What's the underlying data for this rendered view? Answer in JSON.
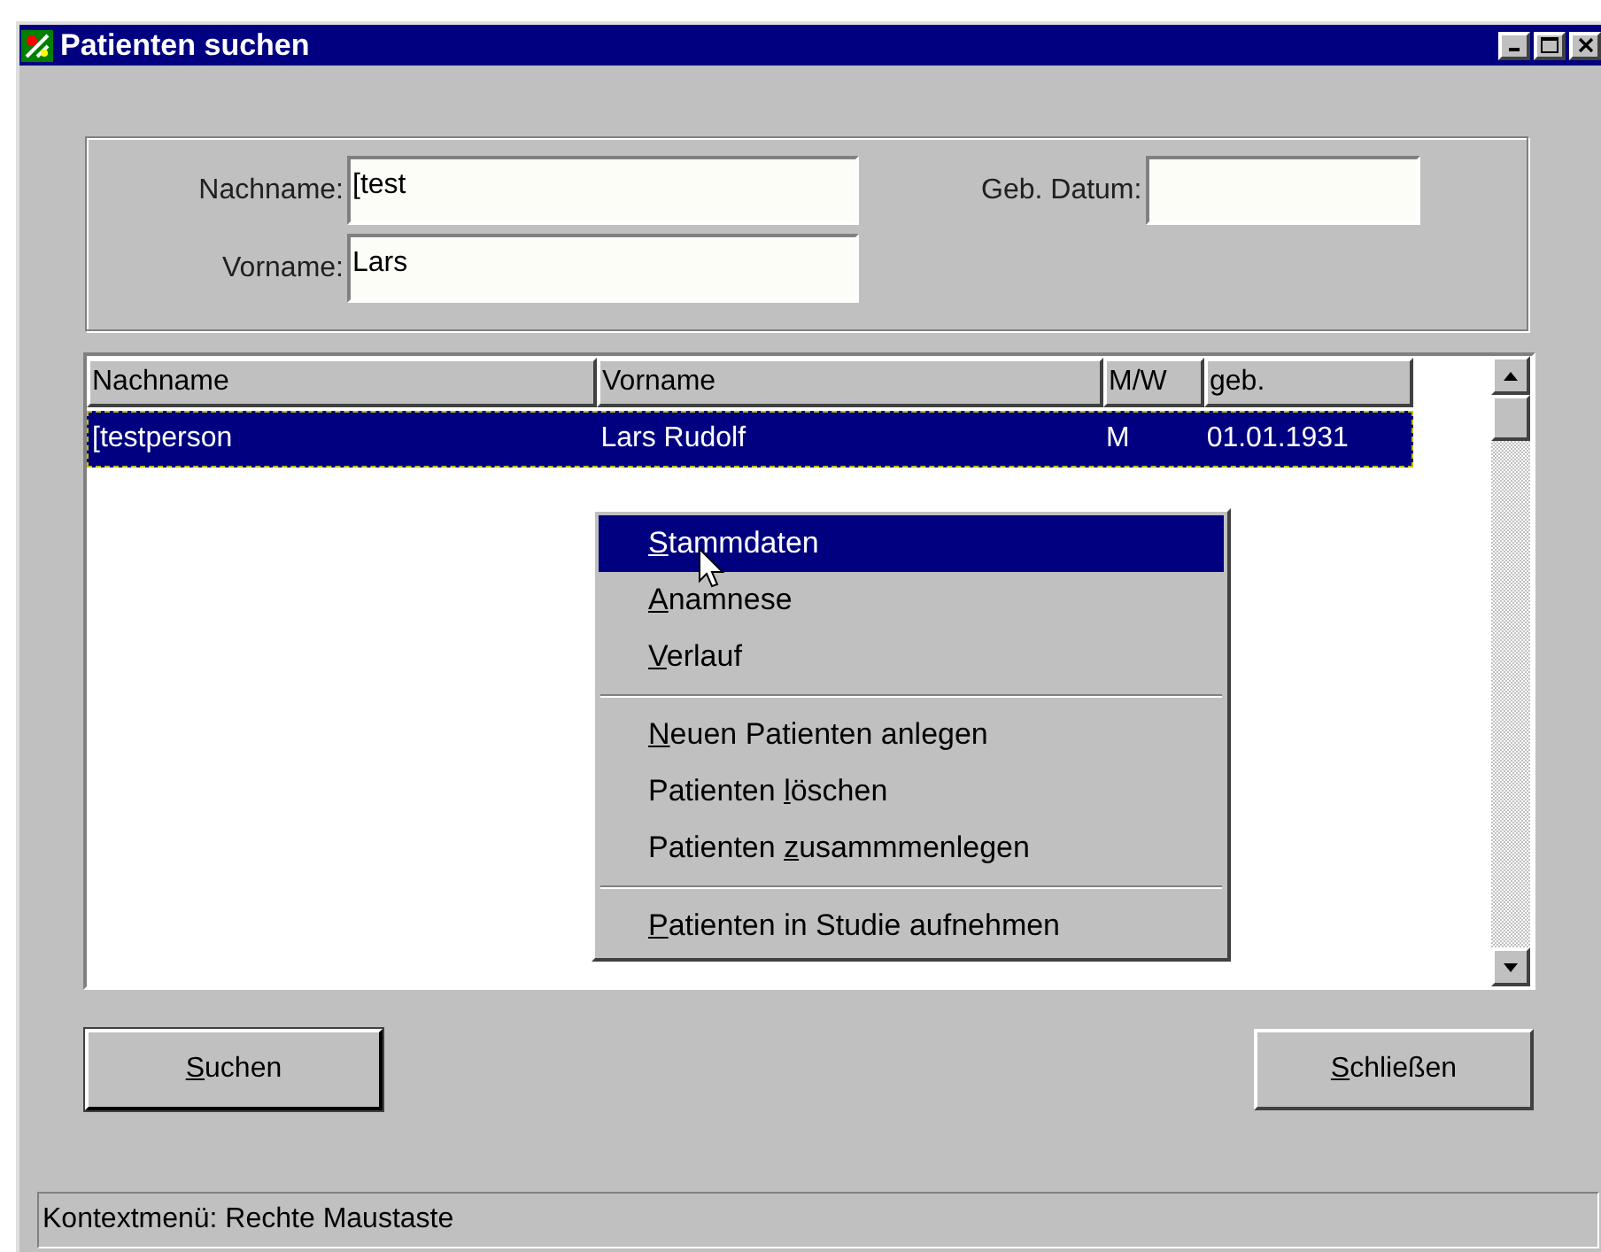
{
  "window": {
    "title": "Patienten suchen"
  },
  "search": {
    "fields": [
      {
        "label": "Nachname:",
        "value": "[test"
      },
      {
        "label": "Vorname:",
        "value": "Lars"
      }
    ],
    "birth_date": {
      "label": "Geb. Datum:"
    }
  },
  "table": {
    "columns": [
      "Nachname",
      "Vorname",
      "M/W",
      "geb."
    ],
    "rows": [
      {
        "cells": [
          "[testperson",
          "Lars Rudolf",
          "M",
          "01.01.1931"
        ],
        "selected": true
      }
    ]
  },
  "context_menu": {
    "groups": [
      [
        {
          "key": "S",
          "rest": "tammdaten",
          "selected": true
        },
        {
          "key": "A",
          "rest": "namnese",
          "selected": false
        },
        {
          "key": "V",
          "rest": "erlauf",
          "selected": false
        }
      ],
      [
        {
          "key": "N",
          "rest": "euen Patienten anlegen",
          "selected": false
        },
        {
          "prefix": "Patienten ",
          "key": "l",
          "rest": "öschen",
          "selected": false
        },
        {
          "prefix": "Patienten ",
          "key": "z",
          "rest": "usammmenlegen",
          "selected": false
        }
      ],
      [
        {
          "key": "P",
          "rest": "atienten in Studie aufnehmen",
          "selected": false
        }
      ]
    ]
  },
  "buttons": [
    {
      "key": "S",
      "rest": "uchen",
      "default": true
    },
    {
      "key": "S",
      "rest": "chließen",
      "default": false
    }
  ],
  "status_bar": "Kontextmenü: Rechte Maustaste"
}
